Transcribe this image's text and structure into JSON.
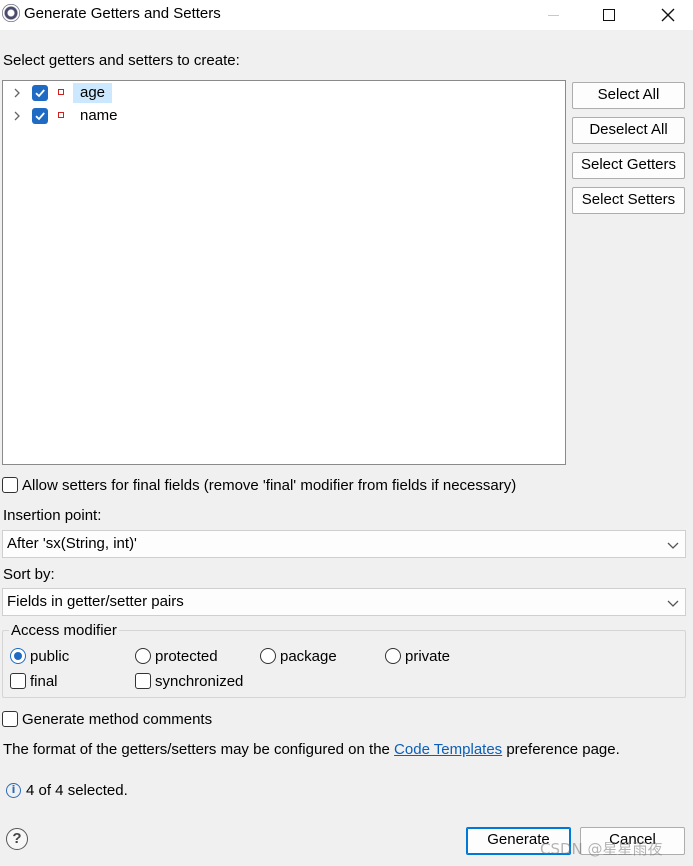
{
  "window": {
    "title": "Generate Getters and Setters"
  },
  "tree": {
    "heading": "Select getters and setters to create:",
    "items": [
      {
        "label": "age",
        "checked": true,
        "selected": true
      },
      {
        "label": "name",
        "checked": true,
        "selected": false
      }
    ]
  },
  "side_buttons": {
    "select_all": "Select All",
    "deselect_all": "Deselect All",
    "select_getters": "Select Getters",
    "select_setters": "Select Setters"
  },
  "options": {
    "allow_final_setters": "Allow setters for final fields (remove 'final' modifier from fields if necessary)",
    "insertion_point_label": "Insertion point:",
    "insertion_point_value": "After 'sx(String, int)'",
    "sort_by_label": "Sort by:",
    "sort_by_value": "Fields in getter/setter pairs"
  },
  "access_modifier": {
    "legend": "Access modifier",
    "public": "public",
    "protected": "protected",
    "package": "package",
    "private": "private",
    "final": "final",
    "synchronized": "synchronized",
    "selected": "public"
  },
  "comments": {
    "label": "Generate method comments"
  },
  "footer_text": {
    "before_link": "The format of the getters/setters may be configured on the",
    "link": "Code Templates",
    "after_link": "preference page."
  },
  "status": {
    "text": "4 of 4 selected."
  },
  "buttons": {
    "generate": "Generate",
    "cancel": "Cancel"
  },
  "watermark": "CSDN @星星雨夜",
  "colors": {
    "accent": "#1f6bc4",
    "selection": "#cce8ff",
    "link": "#0b5fb9",
    "field_icon": "#d0211f"
  }
}
